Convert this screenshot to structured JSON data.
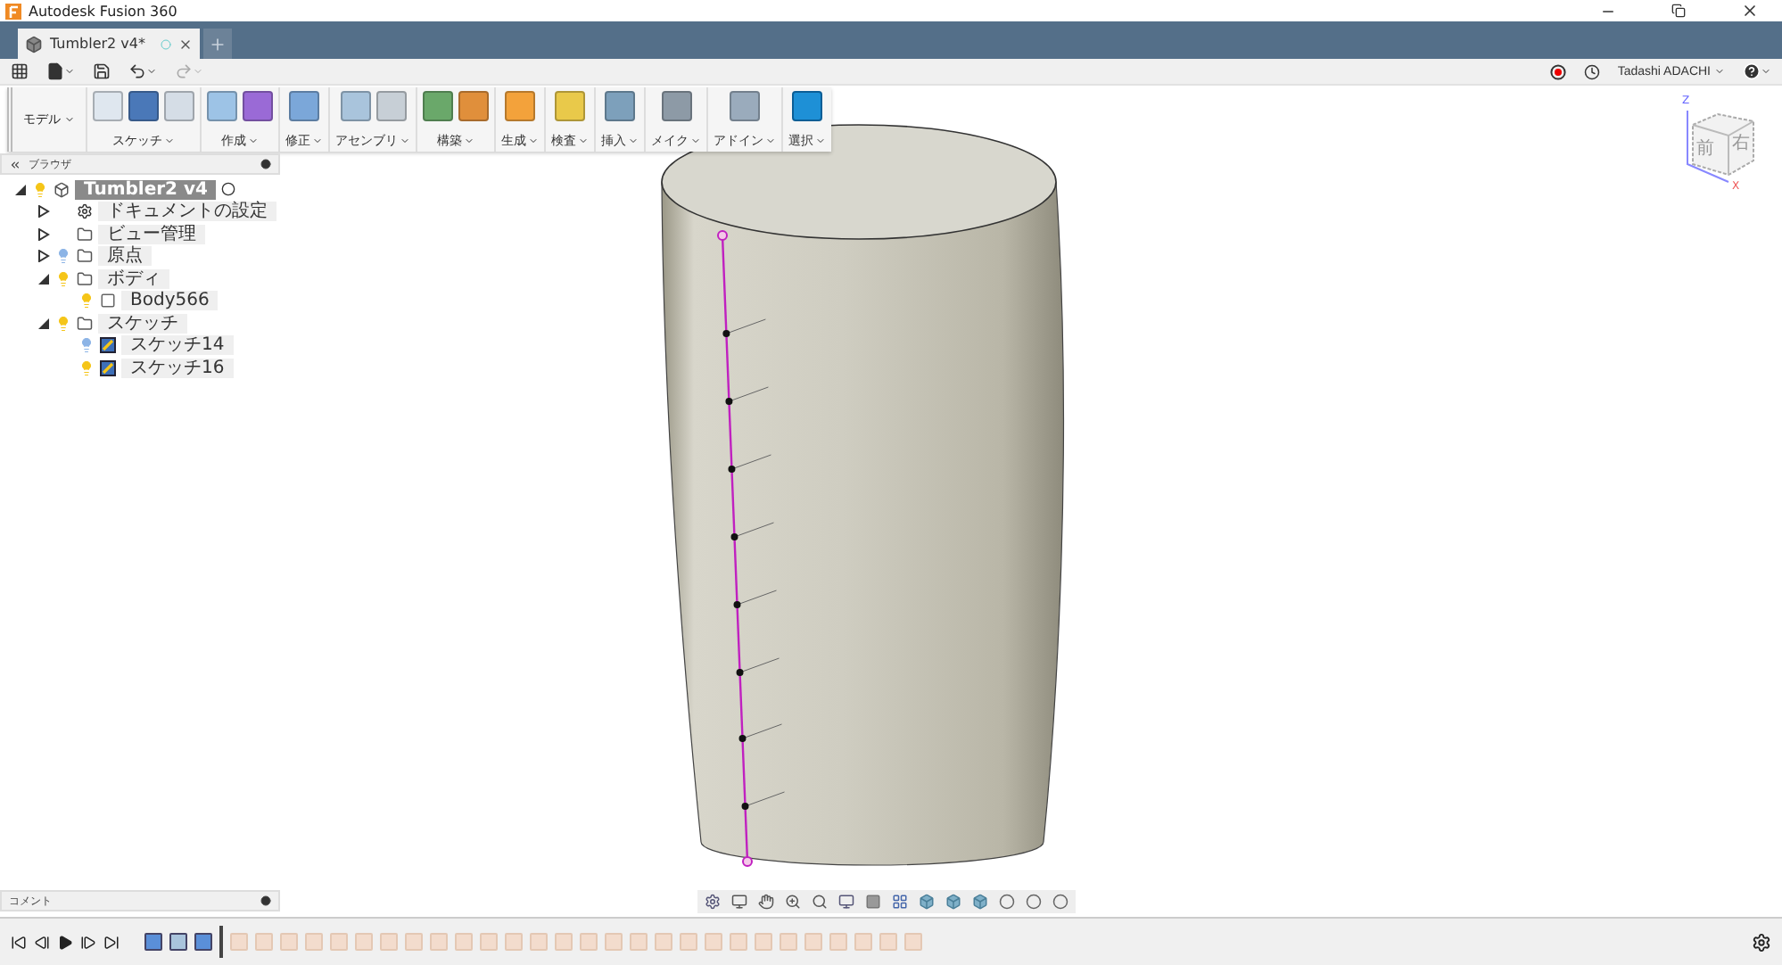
{
  "window": {
    "title": "Autodesk Fusion 360"
  },
  "tabs": [
    {
      "label": "Tumbler2 v4*",
      "selected": true
    }
  ],
  "user": {
    "name": "Tadashi ADACHI"
  },
  "workspace": {
    "label": "モデル"
  },
  "ribbon": [
    {
      "label": "スケッチ",
      "selected": false
    },
    {
      "label": "作成",
      "selected": false
    },
    {
      "label": "修正",
      "selected": false
    },
    {
      "label": "アセンブリ",
      "selected": false
    },
    {
      "label": "構築",
      "selected": false
    },
    {
      "label": "生成",
      "selected": false
    },
    {
      "label": "検査",
      "selected": false
    },
    {
      "label": "挿入",
      "selected": false
    },
    {
      "label": "メイク",
      "selected": false
    },
    {
      "label": "アドイン",
      "selected": false
    },
    {
      "label": "選択",
      "selected": true
    }
  ],
  "browser": {
    "title": "ブラウザ",
    "tree": [
      {
        "label": "Tumbler2 v4",
        "kind": "component",
        "visible": true,
        "expanded": true,
        "selected": true,
        "children": [
          {
            "label": "ドキュメントの設定",
            "kind": "settings",
            "expanded": false,
            "selected": false
          },
          {
            "label": "ビュー管理",
            "kind": "folder",
            "expanded": false,
            "selected": false
          },
          {
            "label": "原点",
            "kind": "folder",
            "visible": false,
            "expanded": false,
            "selected": false
          },
          {
            "label": "ボディ",
            "kind": "folder",
            "visible": true,
            "expanded": true,
            "selected": false,
            "children": [
              {
                "label": "Body566",
                "kind": "body",
                "visible": true,
                "selected": false
              }
            ]
          },
          {
            "label": "スケッチ",
            "kind": "folder",
            "visible": true,
            "expanded": true,
            "selected": false,
            "children": [
              {
                "label": "スケッチ14",
                "kind": "sketch",
                "visible": false,
                "selected": false
              },
              {
                "label": "スケッチ16",
                "kind": "sketch",
                "visible": true,
                "selected": false
              }
            ]
          }
        ]
      }
    ]
  },
  "comments": {
    "title": "コメント"
  },
  "viewcube": {
    "front": "前",
    "right": "右",
    "axis_z": "Z",
    "axis_x": "X"
  },
  "timeline": [
    {
      "kind": "sketch",
      "active": true
    },
    {
      "kind": "loft",
      "active": true
    },
    {
      "kind": "sketch",
      "active": true
    },
    {
      "kind": "fillet",
      "active": false
    },
    {
      "kind": "move",
      "active": false
    },
    {
      "kind": "sketch",
      "active": false
    },
    {
      "kind": "sketch",
      "active": false
    },
    {
      "kind": "extrude",
      "active": false
    },
    {
      "kind": "sketch",
      "active": false
    },
    {
      "kind": "extrude",
      "active": false
    },
    {
      "kind": "move",
      "active": false
    },
    {
      "kind": "shell",
      "active": false
    },
    {
      "kind": "joint",
      "active": false
    },
    {
      "kind": "split",
      "active": false
    },
    {
      "kind": "plane",
      "active": false
    },
    {
      "kind": "fillet",
      "active": false
    },
    {
      "kind": "move",
      "active": false
    },
    {
      "kind": "joint",
      "active": false
    },
    {
      "kind": "shell",
      "active": false
    },
    {
      "kind": "split",
      "active": false
    },
    {
      "kind": "shell",
      "active": false
    },
    {
      "kind": "joint",
      "active": false
    },
    {
      "kind": "split",
      "active": false
    },
    {
      "kind": "plane",
      "active": false
    },
    {
      "kind": "fillet",
      "active": false
    },
    {
      "kind": "move",
      "active": false
    },
    {
      "kind": "joint",
      "active": false
    },
    {
      "kind": "shell",
      "active": false
    },
    {
      "kind": "split",
      "active": false
    },
    {
      "kind": "move",
      "active": false
    },
    {
      "kind": "extrude",
      "active": false
    }
  ]
}
